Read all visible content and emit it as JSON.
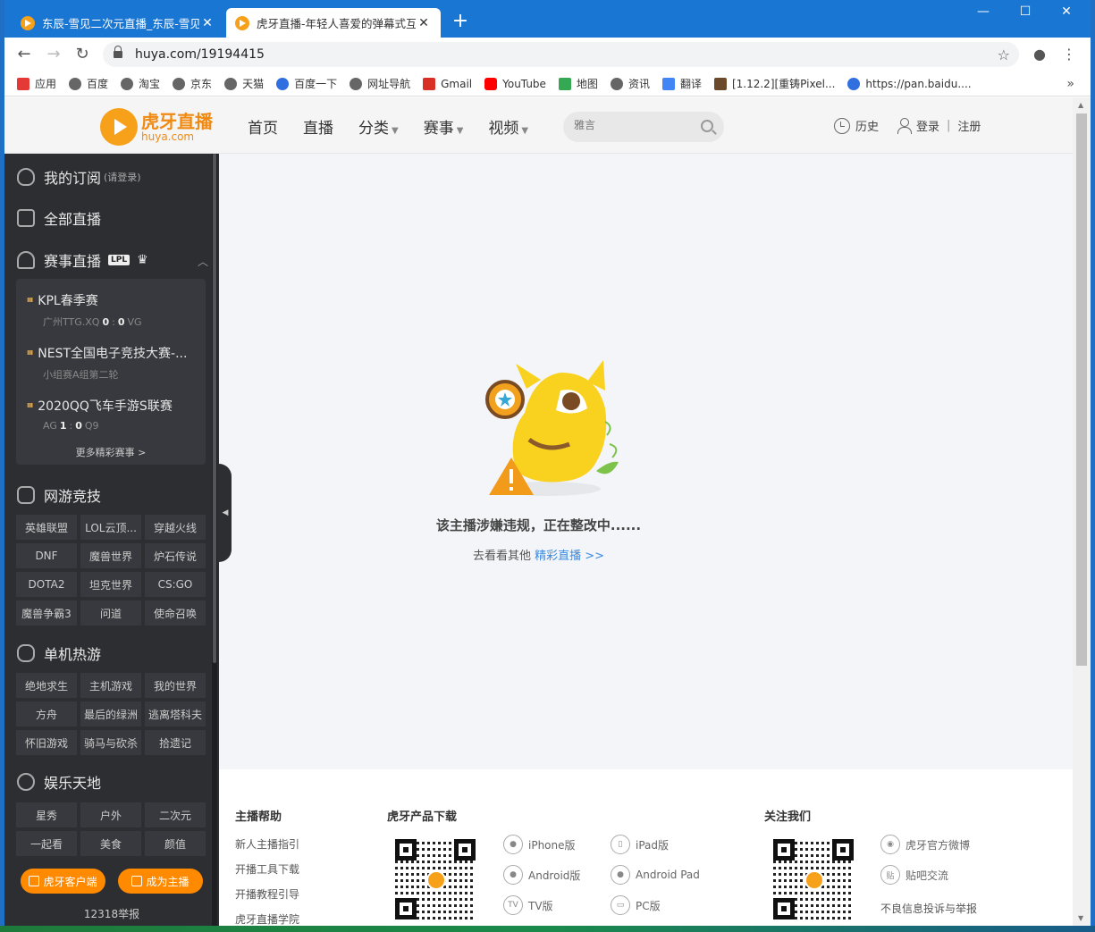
{
  "browser": {
    "tabs": [
      {
        "title": "东辰-雪见二次元直播_东辰-雪见"
      },
      {
        "title": "虎牙直播-年轻人喜爱的弹幕式互"
      }
    ],
    "url": "huya.com/19194415",
    "bookmarks": [
      "应用",
      "百度",
      "淘宝",
      "京东",
      "天猫",
      "百度一下",
      "网址导航",
      "Gmail",
      "YouTube",
      "地图",
      "资讯",
      "翻译",
      "[1.12.2][重铸Pixel...",
      "https://pan.baidu...."
    ],
    "bookmarks_more": "»"
  },
  "header": {
    "logo_cn": "虎牙直播",
    "logo_en": "huya.com",
    "nav": [
      "首页",
      "直播",
      "分类",
      "赛事",
      "视频"
    ],
    "search_placeholder": "雅言",
    "history": "历史",
    "login": "登录",
    "sep": "|",
    "register": "注册"
  },
  "sidebar": {
    "subscribe": "我的订阅",
    "subscribe_hint": "(请登录)",
    "all_live": "全部直播",
    "esports": "赛事直播",
    "lpl_badge": "LPL",
    "matches": [
      {
        "title": "KPL春季赛",
        "team_a": "广州TTG.XQ",
        "score_a": "0",
        "colon": ":",
        "score_b": "0",
        "team_b": "VG"
      },
      {
        "title": "NEST全国电子竞技大赛-...",
        "sub": "小组赛A组第二轮"
      },
      {
        "title": "2020QQ飞车手游S联赛",
        "team_a": "AG",
        "score_a": "1",
        "colon": ":",
        "score_b": "0",
        "team_b": "Q9"
      }
    ],
    "more_matches": "更多精彩赛事 >",
    "online_games": "网游竞技",
    "online_items": [
      "英雄联盟",
      "LOL云顶...",
      "穿越火线",
      "DNF",
      "魔兽世界",
      "炉石传说",
      "DOTA2",
      "坦克世界",
      "CS:GO",
      "魔兽争霸3",
      "问道",
      "使命召唤"
    ],
    "single_games": "单机热游",
    "single_items": [
      "绝地求生",
      "主机游戏",
      "我的世界",
      "方舟",
      "最后的绿洲",
      "逃离塔科夫",
      "怀旧游戏",
      "骑马与砍杀",
      "拾遗记"
    ],
    "entertainment": "娱乐天地",
    "ent_items": [
      "星秀",
      "户外",
      "二次元",
      "一起看",
      "美食",
      "颜值"
    ],
    "client_btn": "虎牙客户端",
    "anchor_btn": "成为主播",
    "report": "12318举报"
  },
  "main": {
    "message": "该主播涉嫌违规，正在整改中......",
    "suggest": "去看看其他",
    "suggest_link": "精彩直播 >>"
  },
  "footer": {
    "help_title": "主播帮助",
    "help_links": [
      "新人主播指引",
      "开播工具下载",
      "开播教程引导",
      "虎牙直播学院"
    ],
    "download_title": "虎牙产品下载",
    "downloads": [
      "iPhone版",
      "iPad版",
      "Android版",
      "Android Pad",
      "TV版",
      "PC版"
    ],
    "follow_title": "关注我们",
    "follow_links": [
      "虎牙官方微博",
      "贴吧交流",
      "不良信息投诉与举报"
    ]
  },
  "colors": {
    "accent": "#ff8a00",
    "link": "#3a8be0",
    "sidebar_bg": "#2d2e32",
    "tab_bar": "#1976d2"
  }
}
